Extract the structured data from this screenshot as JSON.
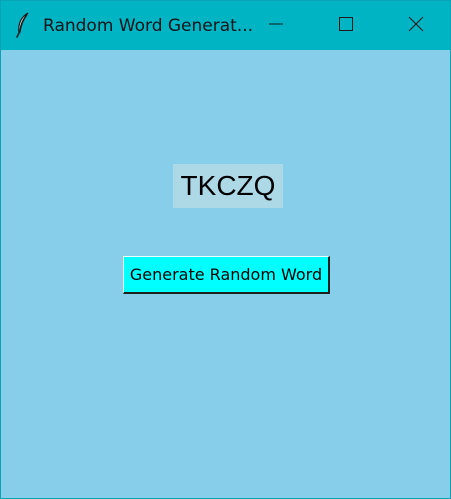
{
  "window": {
    "title": "Random Word Generat...",
    "app_icon": "feather-icon",
    "controls": {
      "minimize": "minimize-icon",
      "maximize": "maximize-icon",
      "close": "close-icon"
    }
  },
  "main": {
    "word": "TKCZQ",
    "button_label": "Generate Random Word"
  },
  "colors": {
    "titlebar": "#00b4c4",
    "background": "#87ceeb",
    "label_background": "#add8e6",
    "button": "#00ffff"
  }
}
